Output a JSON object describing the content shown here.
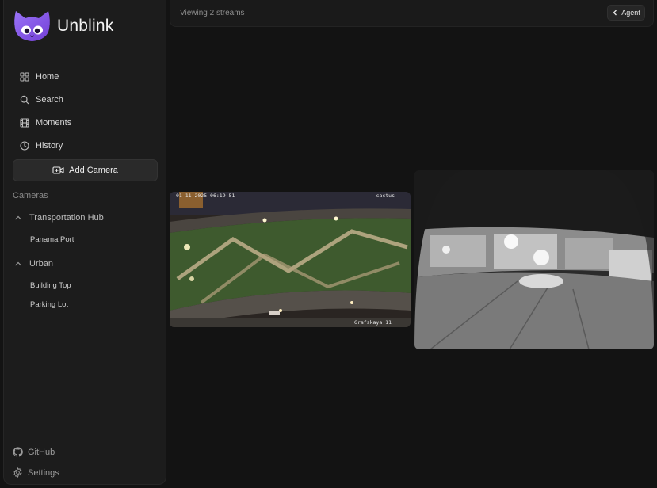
{
  "app": {
    "name": "Unblink"
  },
  "nav": [
    {
      "label": "Home",
      "icon": "grid-icon"
    },
    {
      "label": "Search",
      "icon": "search-icon"
    },
    {
      "label": "Moments",
      "icon": "film-icon"
    },
    {
      "label": "History",
      "icon": "clock-icon"
    }
  ],
  "add_camera": {
    "label": "Add Camera",
    "icon": "video-plus-icon"
  },
  "cameras": {
    "title": "Cameras",
    "groups": [
      {
        "name": "Transportation Hub",
        "items": [
          "Panama Port"
        ]
      },
      {
        "name": "Urban",
        "items": [
          "Building Top",
          "Parking Lot"
        ]
      }
    ]
  },
  "footer": {
    "github": "GitHub",
    "settings": "Settings"
  },
  "topbar": {
    "status": "Viewing 2 streams",
    "agent_label": "Agent"
  },
  "streams": [
    {
      "osd_top_left": "01-11-2025 06:19:51",
      "osd_top_right": "cactus",
      "osd_bottom_right": "Grafskaya 11"
    },
    {}
  ],
  "colors": {
    "background": "#131313",
    "sidebar": "#1c1c1c",
    "accent": "#7c4dff"
  }
}
